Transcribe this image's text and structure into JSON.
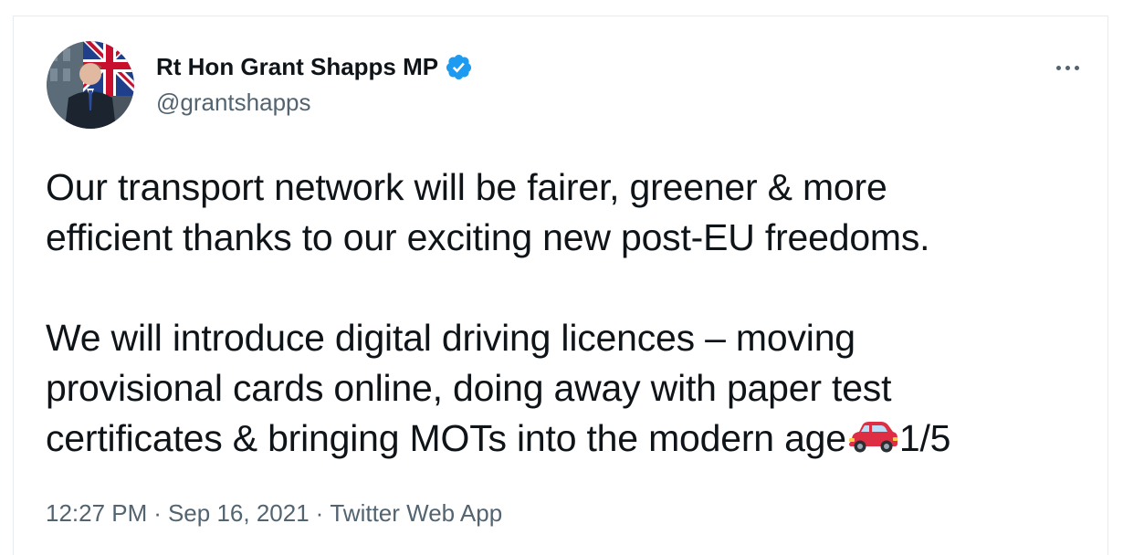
{
  "author": {
    "display_name": "Rt Hon Grant Shapps MP",
    "handle": "@grantshapps",
    "verified": true,
    "verified_color": "#1d9bf0"
  },
  "tweet": {
    "lines_paragraph_1": [
      "Our transport network will be fairer, greener & more",
      "efficient thanks to our exciting new post-EU freedoms."
    ],
    "lines_paragraph_2": [
      "We will introduce digital driving licences – moving",
      "provisional cards online, doing away with paper test",
      "certificates & bringing MOTs into the modern age"
    ],
    "emoji": "car-emoji",
    "thread_counter": "1/5"
  },
  "meta": {
    "time": "12:27 PM",
    "separator": "·",
    "date": "Sep 16, 2021",
    "source": "Twitter Web App"
  },
  "colors": {
    "text_primary": "#0f1419",
    "text_secondary": "#536471",
    "border": "#e6ecf0"
  }
}
